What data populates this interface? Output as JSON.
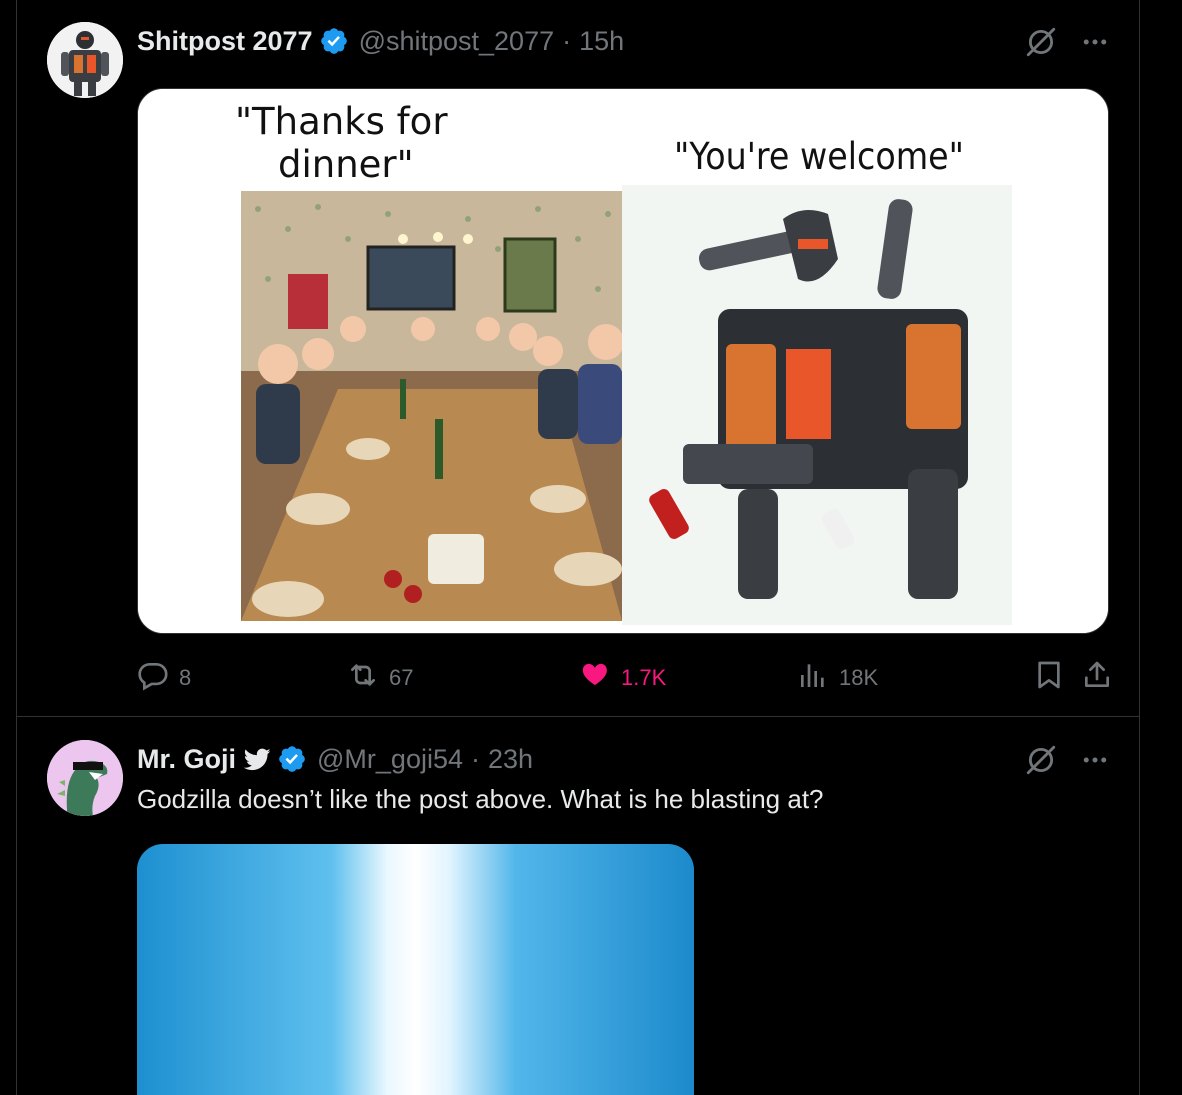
{
  "tweets": [
    {
      "author_name": "Shitpost 2077",
      "handle": "@shitpost_2077",
      "separator": "·",
      "time": "15h",
      "image": {
        "caption_left": "\"Thanks for dinner\"",
        "caption_left_line1": "\"Thanks for",
        "caption_left_line2": "dinner\"",
        "caption_right": "\"You're welcome\""
      },
      "stats": {
        "replies": "8",
        "reposts": "67",
        "likes": "1.7K",
        "views": "18K"
      }
    },
    {
      "author_name": "Mr. Goji",
      "handle": "@Mr_goji54",
      "separator": "·",
      "time": "23h",
      "text": "Godzilla doesn’t like the post above. What is he blasting at?"
    }
  ],
  "icons": {
    "verified": "verified-badge-icon",
    "grok": "grok-icon",
    "more": "more-icon",
    "reply": "reply-icon",
    "repost": "repost-icon",
    "like": "heart-icon",
    "views": "views-icon",
    "bookmark": "bookmark-icon",
    "share": "share-icon",
    "bird": "bird-icon"
  },
  "colors": {
    "background": "#000000",
    "text": "#e7e9ea",
    "muted": "#71767b",
    "verified": "#1d9bf0",
    "like": "#f91880",
    "border": "#2f3336"
  }
}
